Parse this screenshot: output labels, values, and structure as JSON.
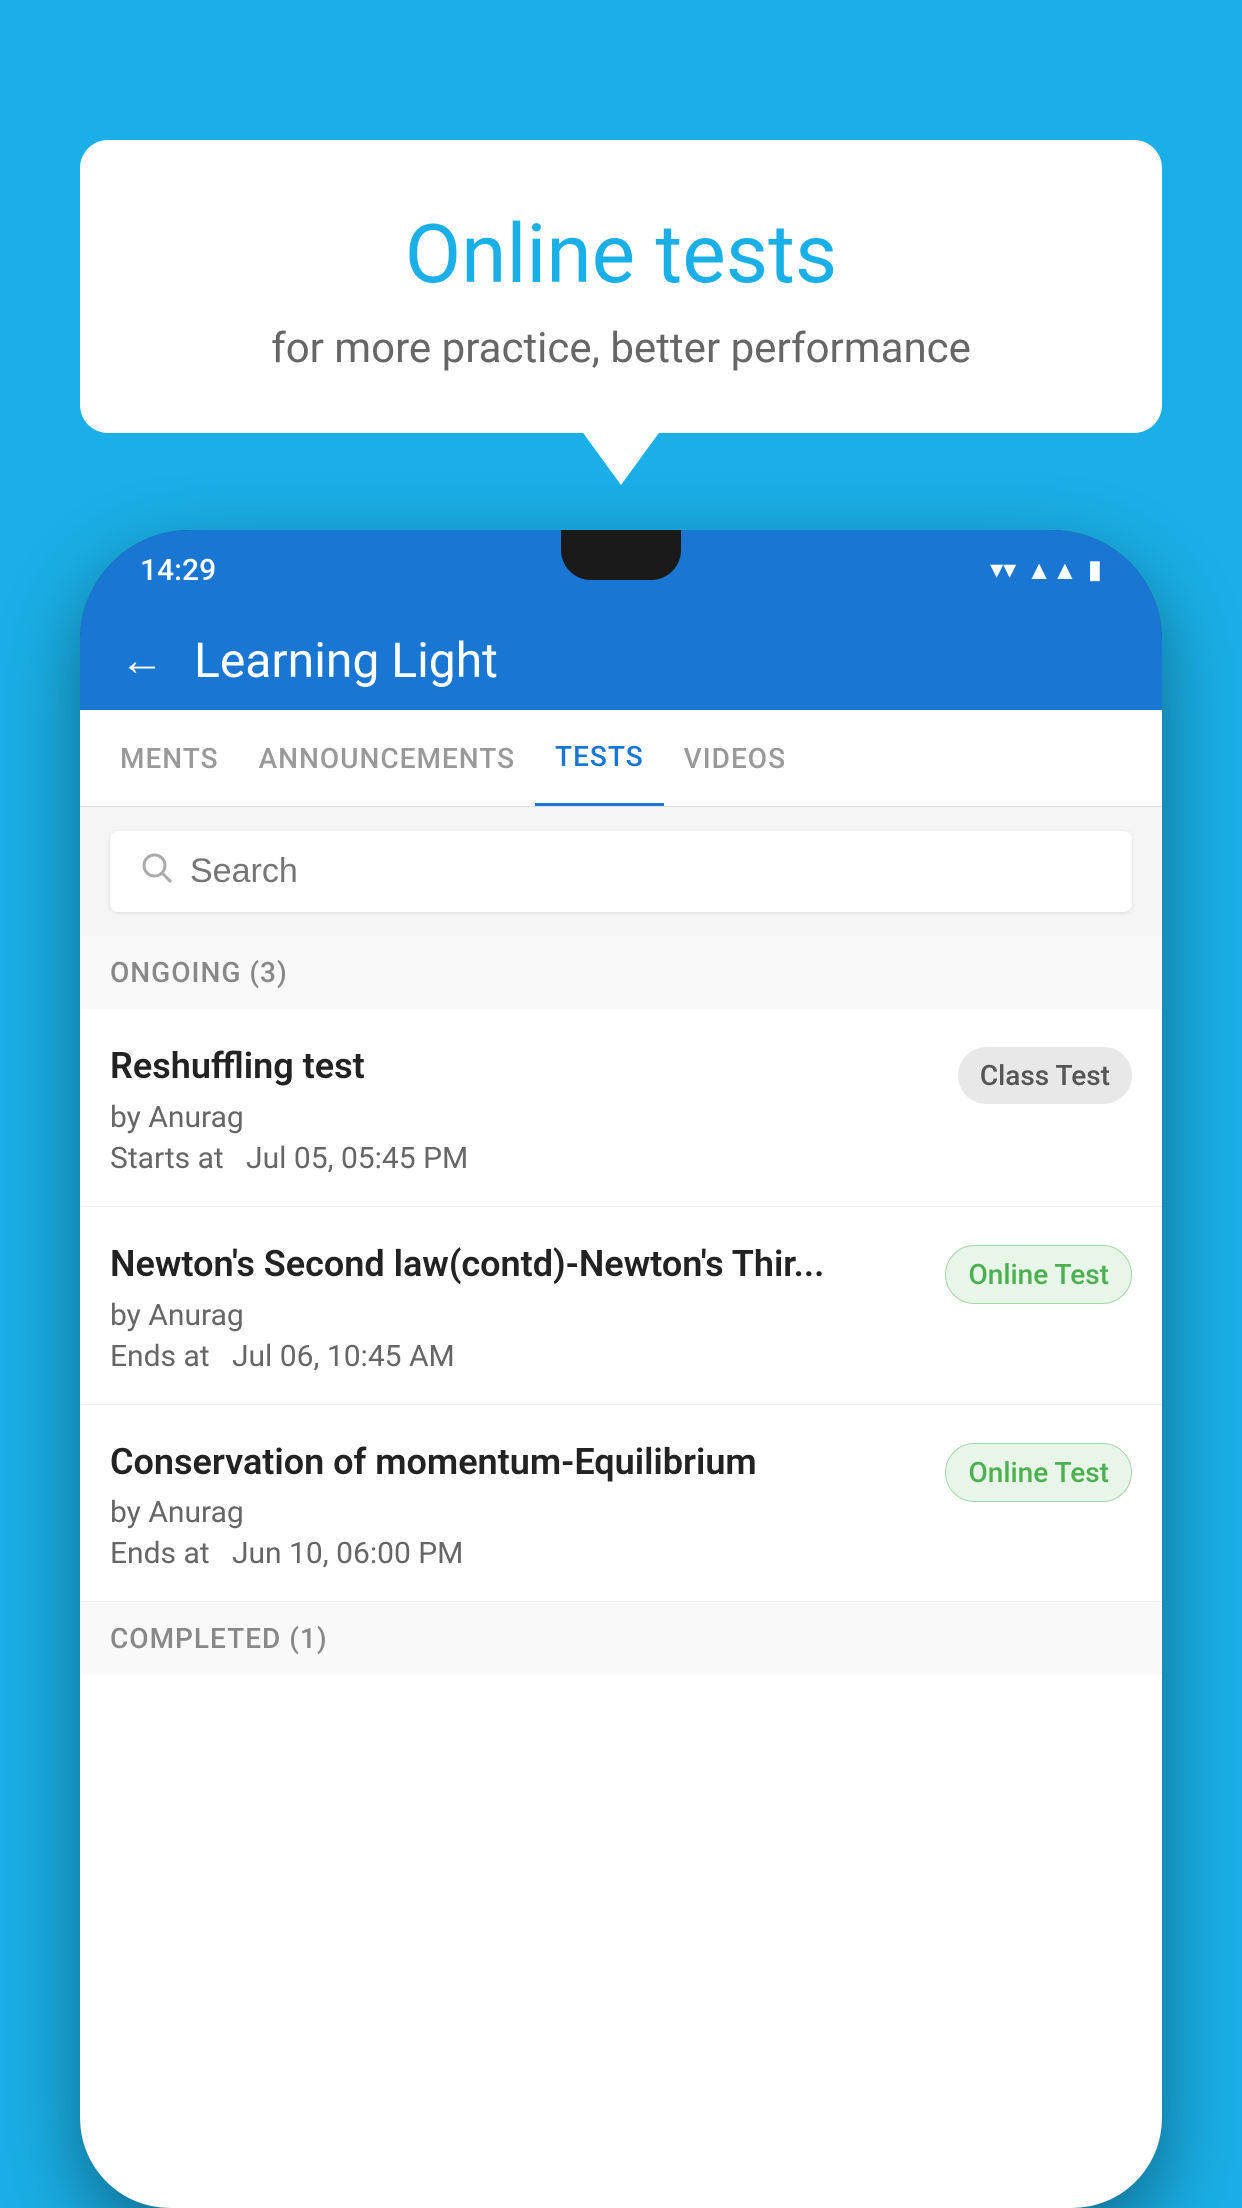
{
  "background_color": "#1AAFE6",
  "speech_bubble": {
    "title": "Online tests",
    "subtitle": "for more practice, better performance"
  },
  "phone": {
    "status_bar": {
      "time": "14:29",
      "icons": [
        "wifi",
        "signal",
        "battery"
      ]
    },
    "header": {
      "title": "Learning Light",
      "back_label": "←"
    },
    "tabs": [
      {
        "label": "MENTS",
        "active": false
      },
      {
        "label": "ANNOUNCEMENTS",
        "active": false
      },
      {
        "label": "TESTS",
        "active": true
      },
      {
        "label": "VIDEOS",
        "active": false
      }
    ],
    "search": {
      "placeholder": "Search"
    },
    "section_ongoing": "ONGOING (3)",
    "tests": [
      {
        "name": "Reshuffling test",
        "author": "by Anurag",
        "time_label": "Starts at",
        "time": "Jul 05, 05:45 PM",
        "badge": "Class Test",
        "badge_type": "class"
      },
      {
        "name": "Newton's Second law(contd)-Newton's Thir...",
        "author": "by Anurag",
        "time_label": "Ends at",
        "time": "Jul 06, 10:45 AM",
        "badge": "Online Test",
        "badge_type": "online"
      },
      {
        "name": "Conservation of momentum-Equilibrium",
        "author": "by Anurag",
        "time_label": "Ends at",
        "time": "Jun 10, 06:00 PM",
        "badge": "Online Test",
        "badge_type": "online"
      }
    ],
    "section_completed": "COMPLETED (1)"
  }
}
